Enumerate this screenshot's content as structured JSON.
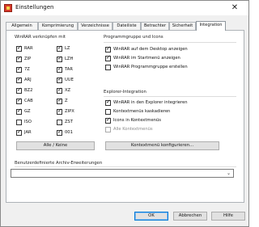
{
  "window": {
    "title": "Einstellungen",
    "close_glyph": "✕"
  },
  "tabs": [
    {
      "label": "Allgemein",
      "active": false
    },
    {
      "label": "Komprimierung",
      "active": false
    },
    {
      "label": "Verzeichnisse",
      "active": false
    },
    {
      "label": "Dateiliste",
      "active": false
    },
    {
      "label": "Betrachter",
      "active": false
    },
    {
      "label": "Sicherheit",
      "active": false
    },
    {
      "label": "Integration",
      "active": true
    }
  ],
  "associations": {
    "title": "WinRAR verknüpfen mit",
    "left": [
      {
        "label": "RAR",
        "checked": true
      },
      {
        "label": "ZIP",
        "checked": true
      },
      {
        "label": "7Z",
        "checked": true
      },
      {
        "label": "ARJ",
        "checked": true
      },
      {
        "label": "BZ2",
        "checked": true
      },
      {
        "label": "CAB",
        "checked": true
      },
      {
        "label": "GZ",
        "checked": true
      },
      {
        "label": "ISO",
        "checked": false
      },
      {
        "label": "JAR",
        "checked": true
      }
    ],
    "right": [
      {
        "label": "LZ",
        "checked": true
      },
      {
        "label": "LZH",
        "checked": true
      },
      {
        "label": "TAR",
        "checked": true
      },
      {
        "label": "UUE",
        "checked": true
      },
      {
        "label": "XZ",
        "checked": true
      },
      {
        "label": "Z",
        "checked": true
      },
      {
        "label": "ZIPX",
        "checked": true
      },
      {
        "label": "ZST",
        "checked": false
      },
      {
        "label": "001",
        "checked": true
      }
    ],
    "toggle_button": "Alle / Keine"
  },
  "interface": {
    "title": "Programmgruppe und Icons",
    "items": [
      {
        "label": "WinRAR auf dem Desktop anzeigen",
        "checked": true
      },
      {
        "label": "WinRAR im Startmenü anzeigen",
        "checked": true
      },
      {
        "label": "WinRAR Programmgruppe erstellen",
        "checked": false
      }
    ]
  },
  "shell": {
    "title": "Explorer-Integration",
    "items": [
      {
        "label": "WinRAR in den Explorer integrieren",
        "checked": true,
        "disabled": false
      },
      {
        "label": "Kontextmenüs kaskadieren",
        "checked": false,
        "disabled": false
      },
      {
        "label": "Icons in Kontextmenüs",
        "checked": true,
        "disabled": false
      },
      {
        "label": "Alle Kontextmenüs",
        "checked": false,
        "disabled": true
      }
    ],
    "configure_button": "Kontextmenü konfigurieren..."
  },
  "user_archives": {
    "title": "Benutzerdefinierte Archiv-Erweiterungen",
    "value": "",
    "arrow_glyph": "⌄"
  },
  "footer": {
    "ok": "OK",
    "cancel": "Abbrechen",
    "help": "Hilfe"
  }
}
